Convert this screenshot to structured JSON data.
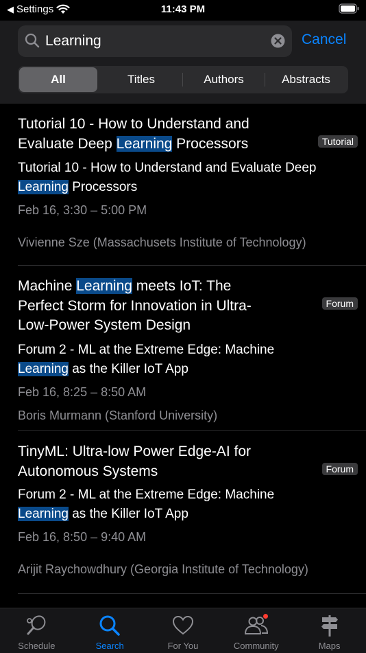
{
  "status_bar": {
    "back_app": "Settings",
    "time": "11:43 PM"
  },
  "search": {
    "query": "Learning",
    "cancel_label": "Cancel"
  },
  "segments": [
    "All",
    "Titles",
    "Authors",
    "Abstracts"
  ],
  "results": [
    {
      "title_parts": [
        "Tutorial 10 - How to Understand and Evaluate Deep ",
        "Learning",
        " Processors"
      ],
      "badge": "Tutorial",
      "session_parts": [
        "Tutorial 10 - How to Understand and Evaluate Deep ",
        "Learning",
        " Processors"
      ],
      "time": "Feb 16, 3:30 – 5:00 PM",
      "person": "Vivienne Sze (Massachusets Institute of Technology)"
    },
    {
      "title_parts": [
        "Machine ",
        "Learning",
        " meets IoT: The Perfect Storm for Innovation in Ultra-Low-Power System Design"
      ],
      "badge": "Forum",
      "session_parts": [
        "Forum 2 - ML at the Extreme Edge: Machine ",
        "Learning",
        " as the Killer IoT App"
      ],
      "time": "Feb 16, 8:25 – 8:50 AM",
      "person": "Boris Murmann (Stanford University)"
    },
    {
      "title_parts": [
        "TinyML: Ultra-low Power Edge-AI for Autonomous Systems",
        "",
        ""
      ],
      "badge": "Forum",
      "session_parts": [
        "Forum 2 - ML at the Extreme Edge: Machine ",
        "Learning",
        " as the Killer IoT App"
      ],
      "time": "Feb 16, 8:50 – 9:40 AM",
      "person": "Arijit Raychowdhury (Georgia Institute of Technology)"
    }
  ],
  "tabs": [
    {
      "label": "Schedule",
      "icon": "tennis-racket-icon"
    },
    {
      "label": "Search",
      "icon": "search-icon"
    },
    {
      "label": "For You",
      "icon": "heart-icon"
    },
    {
      "label": "Community",
      "icon": "people-icon"
    },
    {
      "label": "Maps",
      "icon": "signpost-icon"
    }
  ],
  "colors": {
    "accent": "#0a84ff",
    "highlight": "#0a4a8a",
    "secondary_text": "#8e8e93",
    "notification": "#ff3b30"
  }
}
